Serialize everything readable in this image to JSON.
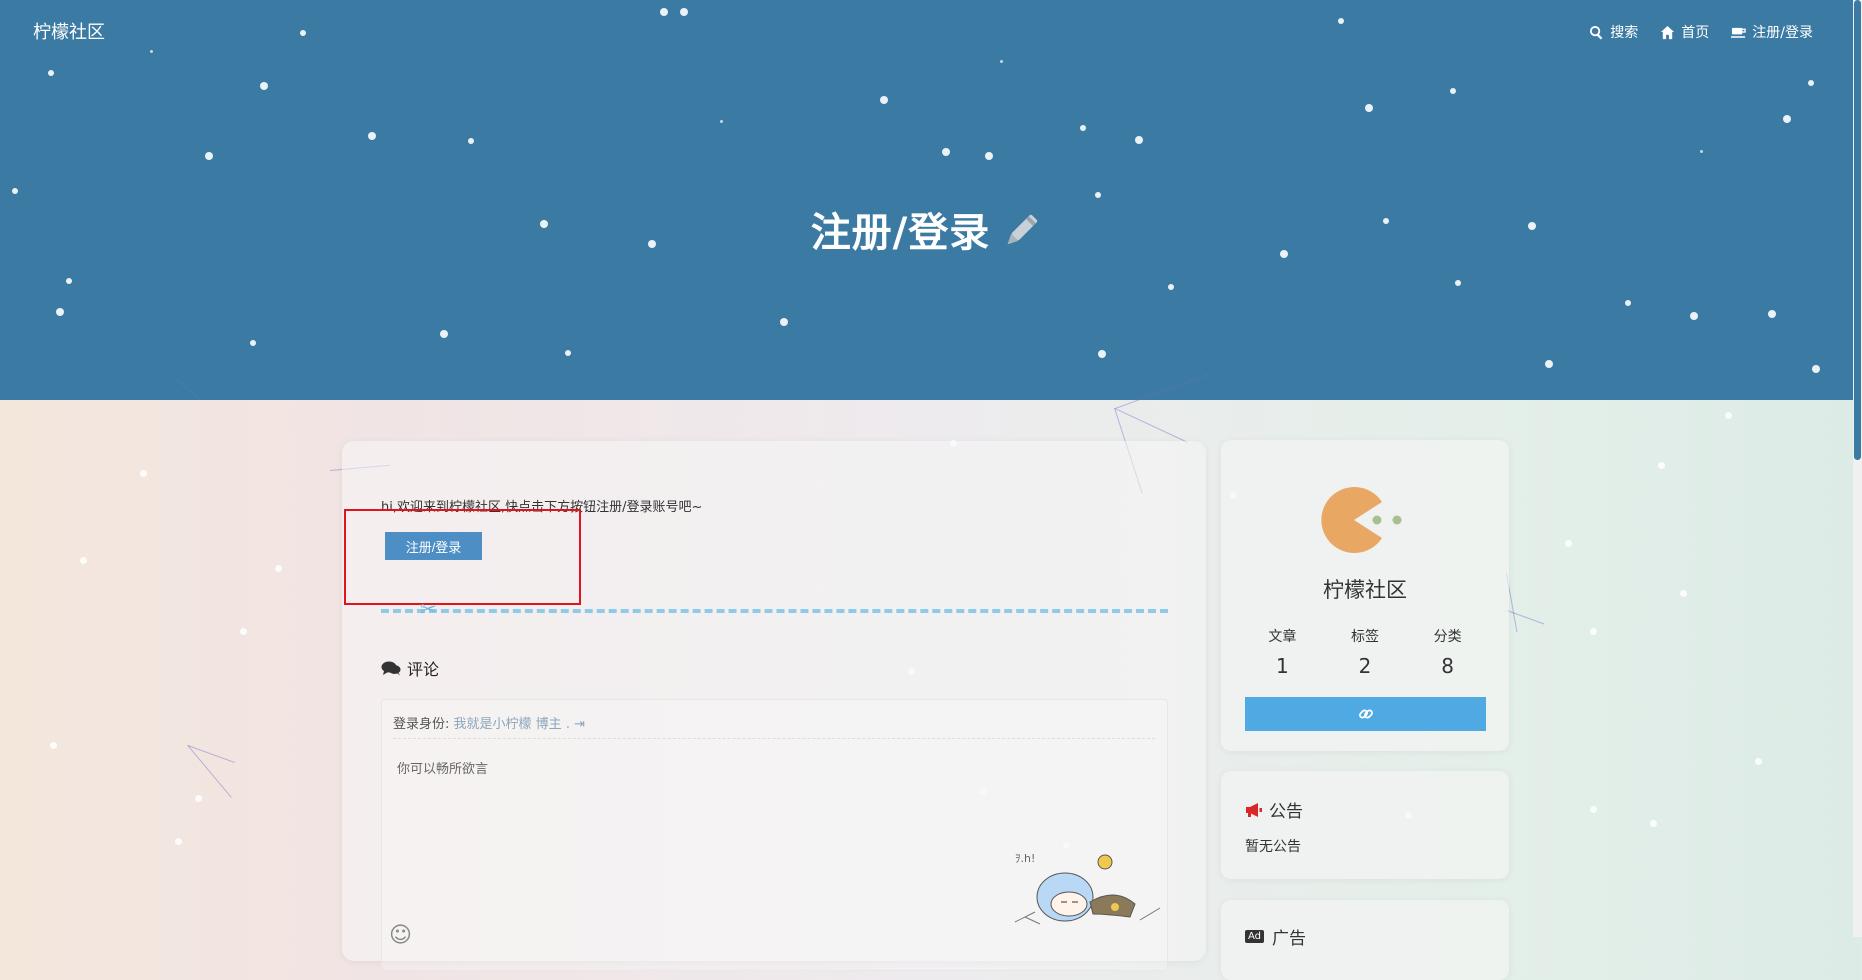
{
  "header": {
    "brand": "柠檬社区",
    "nav": {
      "search": "搜索",
      "home": "首页",
      "register_login": "注册/登录"
    },
    "hero_title": "注册/登录"
  },
  "main": {
    "intro": "hi,欢迎来到柠檬社区,快点击下方按钮注册/登录账号吧~",
    "register_button": "注册/登录",
    "comment_heading": "评论",
    "login_prefix": "登录身份:",
    "login_name": "我就是小柠檬 博主",
    "login_suffix": ".",
    "comment_placeholder": "你可以畅所欲言"
  },
  "sidebar": {
    "site_name": "柠檬社区",
    "stats": [
      {
        "label": "文章",
        "value": "1"
      },
      {
        "label": "标签",
        "value": "2"
      },
      {
        "label": "分类",
        "value": "8"
      }
    ],
    "notice_title": "公告",
    "notice_body": "暂无公告",
    "ad_badge": "Ad",
    "ad_title": "广告"
  },
  "colors": {
    "banner": "#3b7aa3",
    "button": "#4d8ec4",
    "link_button": "#4fa9e3",
    "highlight": "#e0141a"
  }
}
